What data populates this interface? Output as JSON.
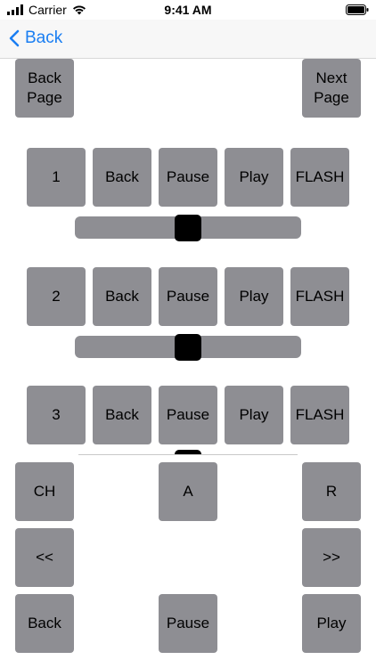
{
  "status_bar": {
    "carrier": "Carrier",
    "time": "9:41 AM"
  },
  "nav": {
    "back_label": "Back"
  },
  "page_nav": {
    "back_page": "Back\nPage",
    "next_page": "Next\nPage"
  },
  "channels": [
    {
      "number": "1",
      "back": "Back",
      "pause": "Pause",
      "play": "Play",
      "flash": "FLASH",
      "level": 0.5
    },
    {
      "number": "2",
      "back": "Back",
      "pause": "Pause",
      "play": "Play",
      "flash": "FLASH",
      "level": 0.5
    },
    {
      "number": "3",
      "back": "Back",
      "pause": "Pause",
      "play": "Play",
      "flash": "FLASH",
      "level": 0.5
    }
  ],
  "controls": {
    "ch": "CH",
    "a": "A",
    "r": "R",
    "rewind": "<<",
    "forward": ">>",
    "back": "Back",
    "pause": "Pause",
    "play": "Play"
  }
}
